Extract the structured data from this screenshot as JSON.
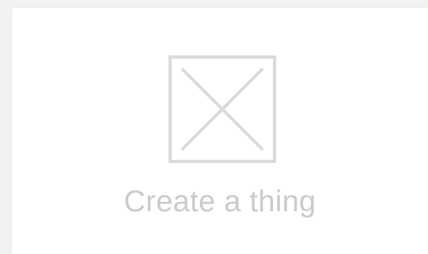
{
  "empty_state": {
    "icon": "image-placeholder-icon",
    "label": "Create a thing"
  },
  "colors": {
    "background": "#f1f3f2",
    "card": "#ffffff",
    "icon_stroke": "#dadada",
    "label_text": "#cbcbcb"
  }
}
